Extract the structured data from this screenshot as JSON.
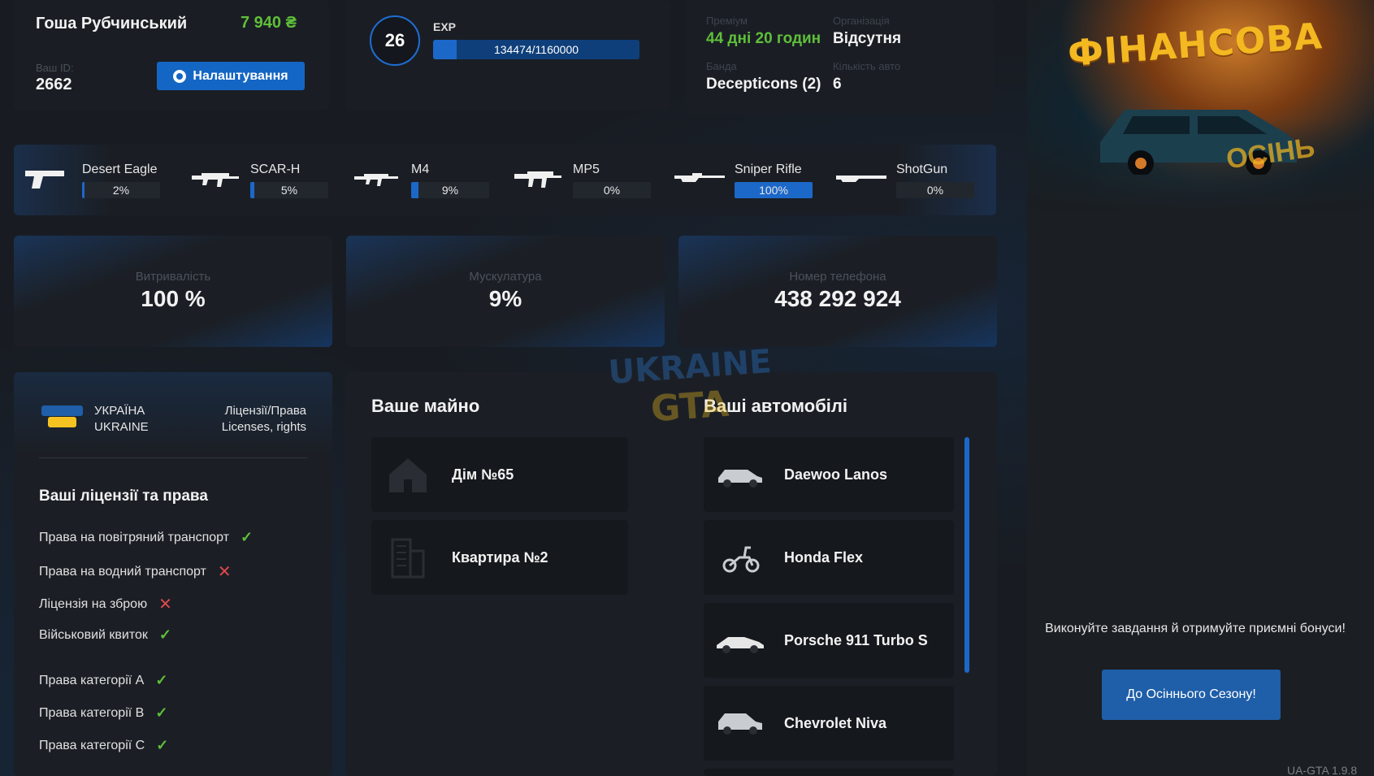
{
  "profile": {
    "name": "Гоша Рубчинський",
    "money": "7 940 ₴",
    "id_label": "Ваш ID:",
    "id_value": "2662",
    "settings_label": "Налаштування",
    "level": "26",
    "exp_label": "EXP",
    "exp_text": "134474/1160000",
    "exp_fraction": 0.116
  },
  "info": {
    "premium_label": "Преміум",
    "premium_value": "44 дні 20 годин",
    "org_label": "Організація",
    "org_value": "Відсутня",
    "gang_label": "Банда",
    "gang_value": "Decepticons (2)",
    "cars_label": "Кількість авто",
    "cars_value": "6"
  },
  "weapons": [
    {
      "name": "Desert Eagle",
      "pct": "2%",
      "value": 2,
      "icon": "pistol-icon"
    },
    {
      "name": "SCAR-H",
      "pct": "5%",
      "value": 5,
      "icon": "rifle-icon"
    },
    {
      "name": "M4",
      "pct": "9%",
      "value": 9,
      "icon": "rifle-icon"
    },
    {
      "name": "MP5",
      "pct": "0%",
      "value": 0,
      "icon": "smg-icon"
    },
    {
      "name": "Sniper Rifle",
      "pct": "100%",
      "value": 100,
      "icon": "sniper-icon"
    },
    {
      "name": "ShotGun",
      "pct": "0%",
      "value": 0,
      "icon": "shotgun-icon"
    }
  ],
  "stats": [
    {
      "label": "Витривалість",
      "value": "100 %"
    },
    {
      "label": "Мускулатура",
      "value": "9%"
    },
    {
      "label": "Номер телефона",
      "value": "438 292 924"
    }
  ],
  "licenses": {
    "org_line1": "УКРАЇНА",
    "org_line2": "UKRAINE",
    "type_line1": "Ліцензії/Права",
    "type_line2": "Licenses, rights",
    "title": "Ваші ліцензії та права",
    "items": [
      {
        "label": "Права на повітряний транспорт",
        "ok": true
      },
      {
        "label": "Права на водний транспорт",
        "ok": false
      },
      {
        "label": "Ліцензія на зброю",
        "ok": false
      },
      {
        "label": "Військовий квиток",
        "ok": true
      },
      {
        "label": "Права категорії A",
        "ok": true
      },
      {
        "label": "Права категорії B",
        "ok": true
      },
      {
        "label": "Права категорії C",
        "ok": true
      }
    ]
  },
  "property": {
    "title": "Ваше майно",
    "items": [
      {
        "label": "Дім №65",
        "icon": "house-icon"
      },
      {
        "label": "Квартира №2",
        "icon": "building-icon"
      }
    ]
  },
  "vehicles": {
    "title": "Ваші автомобілі",
    "items": [
      {
        "label": "Daewoo Lanos",
        "icon": "car-icon"
      },
      {
        "label": "Honda Flex",
        "icon": "scooter-icon"
      },
      {
        "label": "Porsche 911 Turbo S",
        "icon": "sportscar-icon"
      },
      {
        "label": "Chevrolet Niva",
        "icon": "suv-icon"
      }
    ]
  },
  "promo": {
    "banner_title": "ФІНАНСОВА",
    "banner_sub": "ОСІНЬ",
    "text": "Виконуйте завдання й отримуйте приємні бонуси!",
    "button": "До Осіннього Сезону!"
  },
  "watermark": {
    "line1": "UKRAINE",
    "line2": "GTA"
  },
  "version": "UA-GTA 1.9.8",
  "colors": {
    "accent": "#1c68c9",
    "money": "#5fbf3a",
    "cross": "#e0474c",
    "banner": "#f4b821"
  }
}
